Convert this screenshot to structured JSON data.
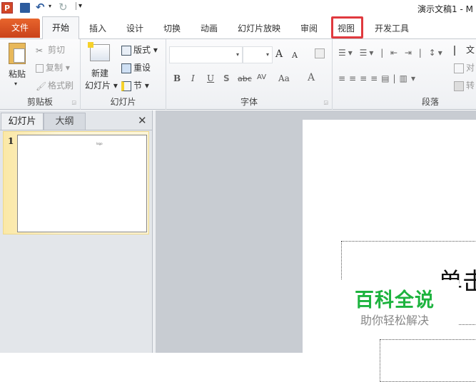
{
  "window": {
    "title": "演示文稿1 - M"
  },
  "qat": {
    "app_icon": "P",
    "icons": [
      "save-icon",
      "undo-icon",
      "redo-icon",
      "customize-icon"
    ]
  },
  "tabs": [
    {
      "label": "文件"
    },
    {
      "label": "开始"
    },
    {
      "label": "插入"
    },
    {
      "label": "设计"
    },
    {
      "label": "切换"
    },
    {
      "label": "动画"
    },
    {
      "label": "幻灯片放映"
    },
    {
      "label": "审阅"
    },
    {
      "label": "视图"
    },
    {
      "label": "开发工具"
    }
  ],
  "ribbon": {
    "clipboard": {
      "label": "剪贴板",
      "paste": "粘贴",
      "cut": "剪切",
      "copy": "复制",
      "format_painter": "格式刷"
    },
    "slides": {
      "label": "幻灯片",
      "new_slide_1": "新建",
      "new_slide_2": "幻灯片",
      "layout": "版式",
      "reset": "重设",
      "section": "节"
    },
    "font": {
      "label": "字体",
      "bold": "B",
      "italic": "I",
      "underline": "U",
      "shadow": "S",
      "strike": "abc",
      "spacing": "AV",
      "case": "Aa",
      "color": "A",
      "grow": "A",
      "shrink": "A"
    },
    "paragraph": {
      "label": "段落",
      "text_dir": "文",
      "align_text": "对",
      "convert": "转"
    }
  },
  "left_pane": {
    "tab_slides": "幻灯片",
    "tab_outline": "大纲",
    "close": "✕",
    "slide_number": "1",
    "thumb_text": "logo"
  },
  "watermark": {
    "title": "百科全说",
    "subtitle": "助你轻松解决",
    "color": "#1db33e"
  },
  "slide": {
    "title_partial": "单击"
  }
}
